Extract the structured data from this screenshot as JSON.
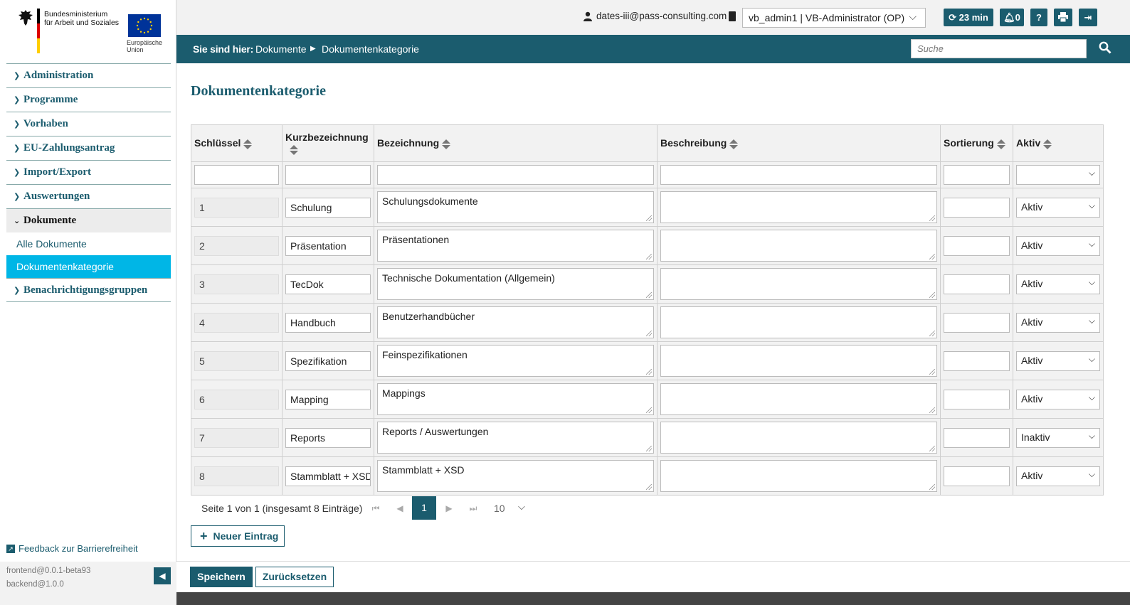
{
  "logo": {
    "ministry_line1": "Bundesministerium",
    "ministry_line2": "für Arbeit und Soziales",
    "eu_line1": "Europäische",
    "eu_line2": "Union"
  },
  "sidebar": {
    "items": [
      {
        "label": "Administration"
      },
      {
        "label": "Programme"
      },
      {
        "label": "Vorhaben"
      },
      {
        "label": "EU-Zahlungsantrag"
      },
      {
        "label": "Import/Export"
      },
      {
        "label": "Auswertungen"
      },
      {
        "label": "Dokumente"
      },
      {
        "label": "Benachrichtigungsgruppen"
      }
    ],
    "subitems": [
      {
        "label": "Alle Dokumente"
      },
      {
        "label": "Dokumentenkategorie"
      }
    ],
    "feedback": "Feedback zur Barrierefreiheit",
    "frontend_version": "frontend@0.0.1-beta93",
    "backend_version": "backend@1.0.0"
  },
  "topbar": {
    "email": "dates-iii@pass-consulting.com",
    "role": "vb_admin1 | VB-Administrator (OP)",
    "session_timer": "23 min",
    "notifications": "0"
  },
  "breadcrumb": {
    "label": "Sie sind hier:",
    "items": [
      "Dokumente",
      "Dokumentenkategorie"
    ]
  },
  "search": {
    "placeholder": "Suche"
  },
  "page": {
    "title": "Dokumentenkategorie"
  },
  "table": {
    "columns": [
      "Schlüssel",
      "Kurzbezeichnung",
      "Bezeichnung",
      "Beschreibung",
      "Sortierung",
      "Aktiv"
    ],
    "rows": [
      {
        "key": "1",
        "short": "Schulung",
        "name": "Schulungsdokumente",
        "description": "",
        "sort": "",
        "active": "Aktiv"
      },
      {
        "key": "2",
        "short": "Präsentation",
        "name": "Präsentationen",
        "description": "",
        "sort": "",
        "active": "Aktiv"
      },
      {
        "key": "3",
        "short": "TecDok",
        "name": "Technische Dokumentation (Allgemein)",
        "description": "",
        "sort": "",
        "active": "Aktiv"
      },
      {
        "key": "4",
        "short": "Handbuch",
        "name": "Benutzerhandbücher",
        "description": "",
        "sort": "",
        "active": "Aktiv"
      },
      {
        "key": "5",
        "short": "Spezifikation",
        "name": "Feinspezifikationen",
        "description": "",
        "sort": "",
        "active": "Aktiv"
      },
      {
        "key": "6",
        "short": "Mapping",
        "name": "Mappings",
        "description": "",
        "sort": "",
        "active": "Aktiv"
      },
      {
        "key": "7",
        "short": "Reports",
        "name": "Reports / Auswertungen",
        "description": "",
        "sort": "",
        "active": "Inaktiv"
      },
      {
        "key": "8",
        "short": "Stammblatt + XSD",
        "name": "Stammblatt + XSD",
        "description": "",
        "sort": "",
        "active": "Aktiv"
      }
    ]
  },
  "pagination": {
    "info": "Seite 1 von 1 (insgesamt 8 Einträge)",
    "current_page": "1",
    "page_size": "10"
  },
  "actions": {
    "new_entry": "Neuer Eintrag",
    "save": "Speichern",
    "reset": "Zurücksetzen"
  },
  "colors": {
    "primary": "#1b5c6e",
    "active_nav": "#00b6e6"
  }
}
